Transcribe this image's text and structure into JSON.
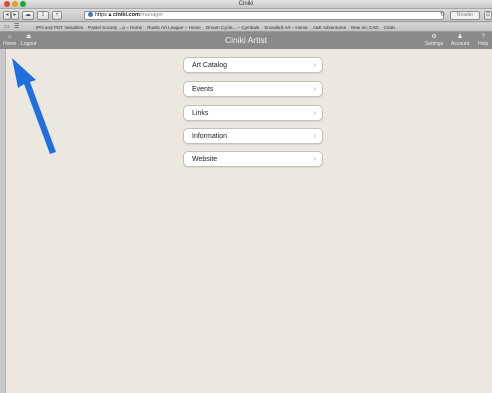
{
  "window": {
    "title": "Ciniki"
  },
  "toolbar": {
    "address_host": "ciniki.com",
    "address_scheme": "https",
    "address_path": "/manager",
    "reader_label": "Reader",
    "reload_icon": "reload-icon"
  },
  "bookmarks": {
    "items": [
      "IPN and PDT Variables",
      "Pastel Society ...a – Home",
      "Rustic Art League – Home",
      "Dream Cycle... – Cymbals",
      "Snowbird Art – Home",
      "A&E Adventures",
      "New Inc CAD",
      "Ciniki"
    ]
  },
  "appbar": {
    "title": "Ciniki Artist",
    "home_label": "Home",
    "logout_label": "Logout",
    "settings_label": "Settings",
    "account_label": "Account",
    "help_label": "Help"
  },
  "menu": {
    "items": [
      {
        "label": "Art Catalog"
      },
      {
        "label": "Events"
      },
      {
        "label": "Links"
      },
      {
        "label": "Information"
      },
      {
        "label": "Website"
      }
    ]
  },
  "colors": {
    "appbar": "#8a8a8a",
    "content_bg": "#ece8df",
    "annotation_arrow": "#1f6fe0"
  }
}
